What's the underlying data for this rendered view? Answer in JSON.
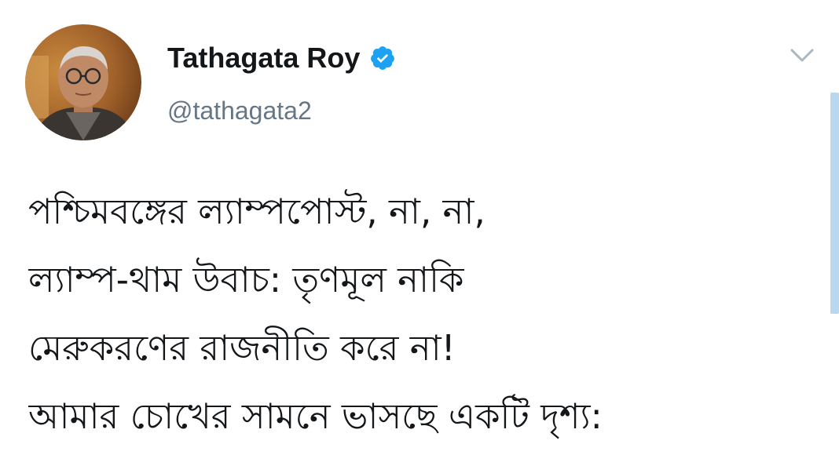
{
  "tweet": {
    "author": {
      "name": "Tathagata Roy",
      "handle": "@tathagata2",
      "verified": true,
      "avatar_icon": "profile-photo"
    },
    "menu_icon": "chevron-down-icon",
    "text_lines": [
      "পশ্চিমবঙ্গের ল্যাম্পপোস্ট, না, না,",
      "ল্যাম্প-থাম উবাচ: তৃণমূল নাকি",
      "মেরুকরণের রাজনীতি করে না!",
      "আমার চোখের সামনে ভাসছে একটি দৃশ্য:"
    ]
  },
  "colors": {
    "name_text": "#14171a",
    "handle_text": "#657786",
    "verified_badge": "#1da1f2",
    "chevron": "#aab8c2",
    "scrollbar": "#b9d7ef"
  }
}
